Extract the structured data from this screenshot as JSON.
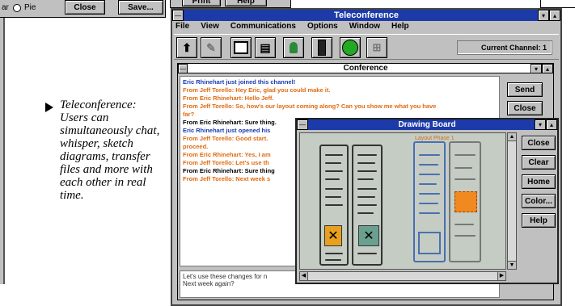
{
  "prev_dialog": {
    "radio_partial": "ar",
    "radio_pie": "Pie",
    "close_label": "Close",
    "save_label": "Save..."
  },
  "top_window": {
    "print_label": "Print",
    "help_label": "Help"
  },
  "caption": {
    "title": "Teleconference:",
    "body": "Users can simultaneously chat, whisper, sketch diagrams, transfer files and more with each other in real time."
  },
  "teleconference": {
    "title": "Teleconference",
    "menu": [
      "File",
      "View",
      "Communications",
      "Options",
      "Window",
      "Help"
    ],
    "toolbar_icons": [
      "join-icon",
      "pen-icon",
      "whiteboard-icon",
      "notes-icon",
      "user-icon",
      "channel-icon",
      "connect-light-icon",
      "directory-icon"
    ],
    "channel_label": "Current Channel: 1"
  },
  "conference": {
    "title": "Conference",
    "send_label": "Send",
    "close_label": "Close",
    "chat_lines": [
      {
        "text": "Eric Rhinehart just joined this channel!",
        "color": "blue"
      },
      {
        "text": "From Jeff Torello:  Hey Eric, glad you could make it.",
        "color": "orange"
      },
      {
        "text": "From Eric Rhinehart:  Hello Jeff.",
        "color": "orange"
      },
      {
        "text": "From Jeff Torello:  So, how's our layout coming along?  Can you show me what you have",
        "color": "orange"
      },
      {
        "text": "    far?",
        "color": "orange"
      },
      {
        "text": "From Eric Rhinehart:  Sure thing.",
        "color": "black"
      },
      {
        "text": "Eric Rhinehart just opened his",
        "color": "blue"
      },
      {
        "text": "From Jeff Torello:  Good start.",
        "color": "orange"
      },
      {
        "text": "    proceed.",
        "color": "orange"
      },
      {
        "text": "From Eric Rhinehart:  Yes, I am",
        "color": "orange"
      },
      {
        "text": "From Jeff Torello:  Let's use th",
        "color": "orange"
      },
      {
        "text": "From Eric Rhinehart:  Sure thing",
        "color": "black"
      },
      {
        "text": "From Jeff Torello:  Next week s",
        "color": "orange"
      }
    ],
    "input_text": "Let's use these changes for n\nNext week again?"
  },
  "drawing_board": {
    "title": "Drawing Board",
    "buttons": [
      "Close",
      "Clear",
      "Home",
      "Color...",
      "Help"
    ],
    "sketch_heading": "Layout Phase 1"
  },
  "colors": {
    "titlebar": "#1c3aa8",
    "chat_blue": "#1a3ab0",
    "chat_orange": "#e06a10",
    "window_gray": "#c0c0c0"
  }
}
